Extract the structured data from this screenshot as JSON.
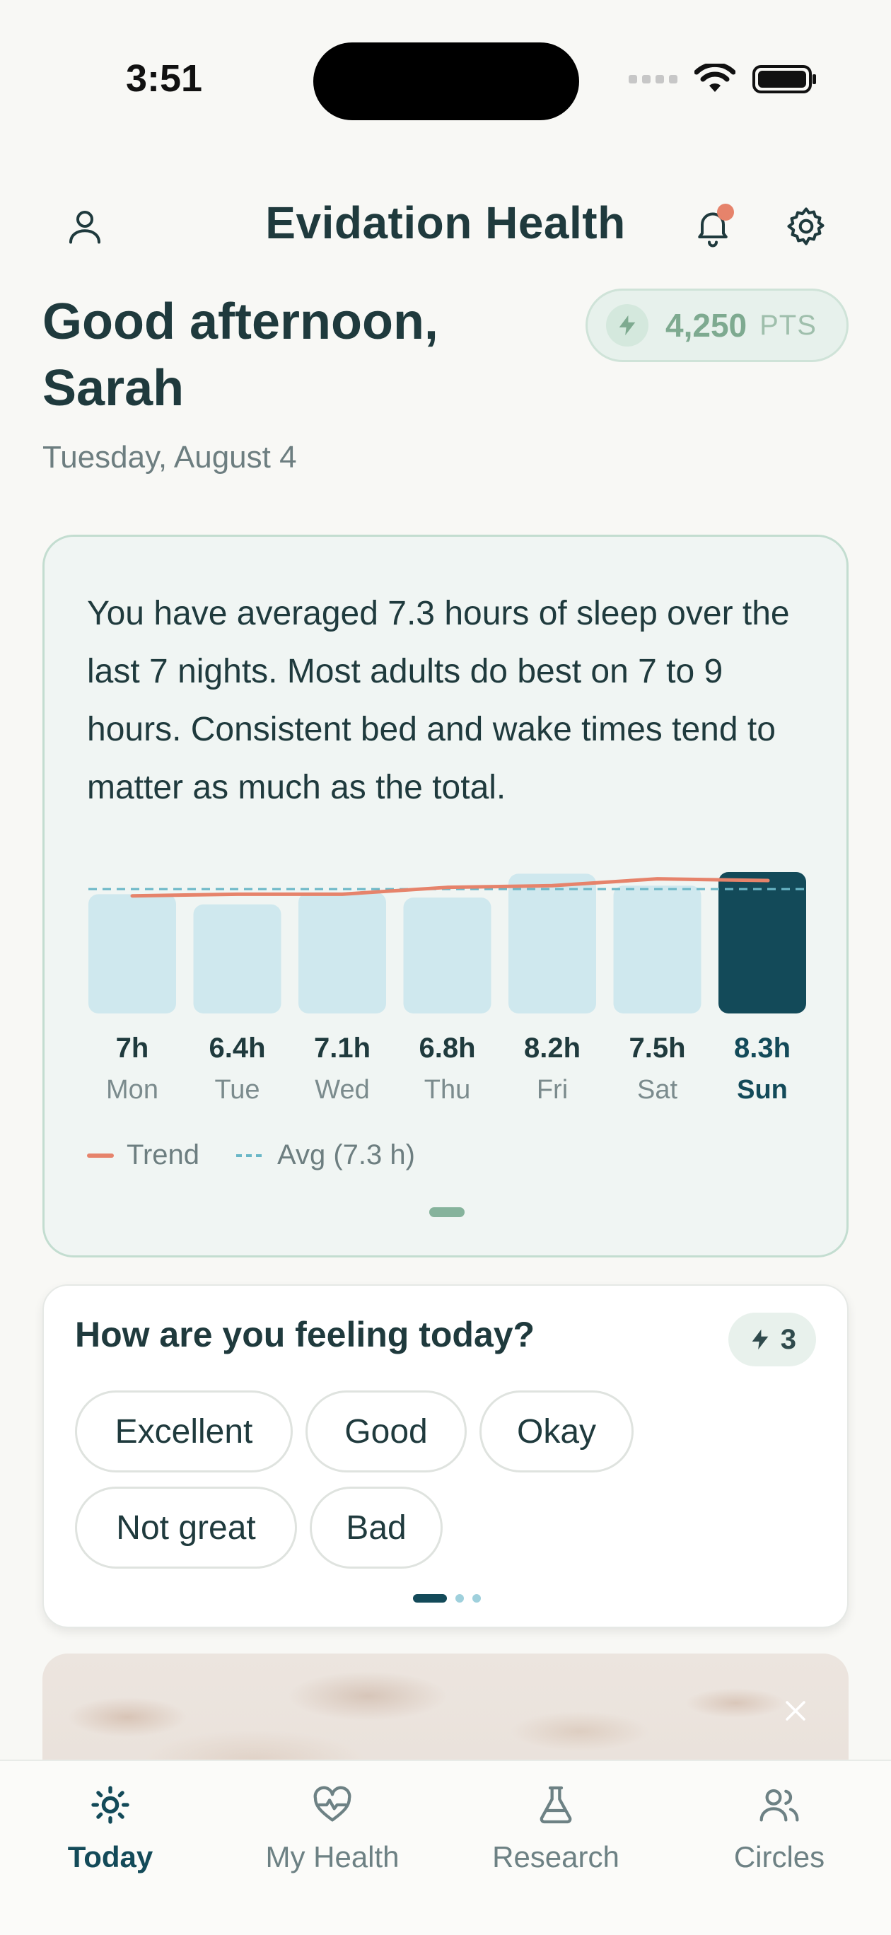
{
  "status_bar": {
    "time": "3:51"
  },
  "header": {
    "title": "Evidation Health"
  },
  "greeting": {
    "text": "Good afternoon, Sarah",
    "date": "Tuesday, August 4"
  },
  "points": {
    "value": "4,250",
    "unit": "PTS"
  },
  "sleep_card": {
    "summary": "You have averaged 7.3 hours of sleep over the last 7 nights. Most adults do best on 7 to 9 hours. Consistent bed and wake times tend to matter as much as the total.",
    "legend": {
      "trend": "Trend",
      "avg": "Avg (7.3 h)"
    }
  },
  "chart_data": {
    "type": "bar",
    "categories": [
      "Mon",
      "Tue",
      "Wed",
      "Thu",
      "Fri",
      "Sat",
      "Sun"
    ],
    "value_labels": [
      "7h",
      "6.4h",
      "7.1h",
      "6.8h",
      "8.2h",
      "7.5h",
      "8.3h"
    ],
    "values": [
      7.0,
      6.4,
      7.1,
      6.8,
      8.2,
      7.5,
      8.3
    ],
    "highlighted": "Sun",
    "trend": [
      6.9,
      7.0,
      7.0,
      7.4,
      7.5,
      7.9,
      7.8
    ],
    "average": 7.3,
    "ylim": [
      0,
      8.3
    ],
    "colors": {
      "bar": "#cfe8ee",
      "highlight": "#134a59",
      "trend": "#e6836b",
      "avg": "#6ab7c7"
    }
  },
  "feeling_card": {
    "title": "How are you feeling today?",
    "points": "3",
    "options": [
      "Excellent",
      "Good",
      "Okay",
      "Not great",
      "Bad"
    ]
  },
  "tabs": [
    {
      "label": "Today",
      "icon": "sun-icon",
      "active": true
    },
    {
      "label": "My Health",
      "icon": "heart-pulse-icon",
      "active": false
    },
    {
      "label": "Research",
      "icon": "flask-icon",
      "active": false
    },
    {
      "label": "Circles",
      "icon": "users-icon",
      "active": false
    }
  ]
}
